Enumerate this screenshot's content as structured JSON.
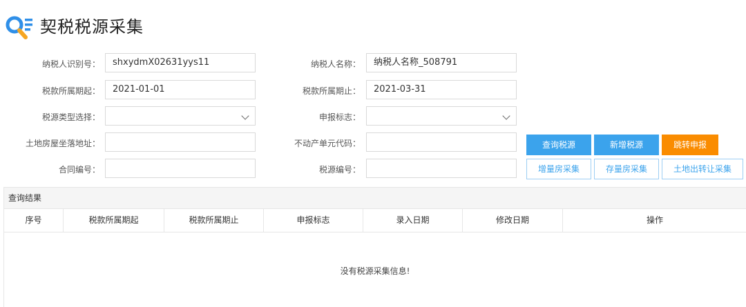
{
  "page": {
    "title": "契税税源采集"
  },
  "form": {
    "taxpayer_id": {
      "label": "纳税人识别号：",
      "value": "shxydmX02631yys11"
    },
    "taxpayer_name": {
      "label": "纳税人名称：",
      "value": "纳税人名称_508791"
    },
    "period_start": {
      "label": "税款所属期起：",
      "value": "2021-01-01"
    },
    "period_end": {
      "label": "税款所属期止：",
      "value": "2021-03-31"
    },
    "source_type": {
      "label": "税源类型选择：",
      "value": ""
    },
    "declare_flag": {
      "label": "申报标志：",
      "value": ""
    },
    "address": {
      "label": "土地房屋坐落地址：",
      "value": ""
    },
    "property_unit_code": {
      "label": "不动产单元代码：",
      "value": ""
    },
    "contract_no": {
      "label": "合同编号：",
      "value": ""
    },
    "source_no": {
      "label": "税源编号：",
      "value": ""
    }
  },
  "buttons": {
    "query": "查询税源",
    "add": "新增税源",
    "jump_declare": "跳转申报",
    "incremental_house": "增量房采集",
    "stock_house": "存量房采集",
    "land_transfer": "土地出转让采集"
  },
  "results": {
    "title": "查询结果",
    "columns": [
      "序号",
      "税款所属期起",
      "税款所属期止",
      "申报标志",
      "录入日期",
      "修改日期",
      "操作"
    ],
    "rows": [],
    "empty_message": "没有税源采集信息!"
  },
  "colors": {
    "primary": "#3ba3ec",
    "accent": "#fa8c00"
  }
}
